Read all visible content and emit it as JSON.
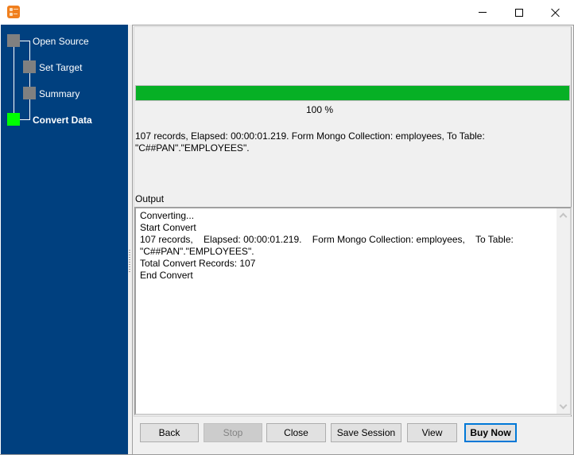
{
  "window": {
    "title": "",
    "controls": {
      "minimize": "minimize",
      "maximize": "maximize",
      "close": "close"
    }
  },
  "sidebar": {
    "steps": [
      {
        "label": "Open Source",
        "state": "done"
      },
      {
        "label": "Set Target",
        "state": "done"
      },
      {
        "label": "Summary",
        "state": "done"
      },
      {
        "label": "Convert Data",
        "state": "active"
      }
    ],
    "colors": {
      "background": "#00407f",
      "inactive_box": "#808080",
      "active_box": "#00ff00"
    }
  },
  "progress": {
    "value_percent": 100,
    "label": "100 %",
    "color": "#06b025"
  },
  "status": {
    "text": "107 records,    Elapsed: 00:00:01.219.    Form Mongo Collection: employees,    To Table: \"C##PAN\".\"EMPLOYEES\"."
  },
  "output": {
    "label": "Output",
    "lines": [
      "Converting...",
      "Start Convert",
      "107 records,    Elapsed: 00:00:01.219.    Form Mongo Collection: employees,    To Table: \"C##PAN\".\"EMPLOYEES\".",
      "Total Convert Records: 107",
      "End Convert"
    ]
  },
  "buttons": {
    "back": "Back",
    "stop": "Stop",
    "close": "Close",
    "save_session": "Save Session",
    "view": "View",
    "buy_now": "Buy Now"
  }
}
